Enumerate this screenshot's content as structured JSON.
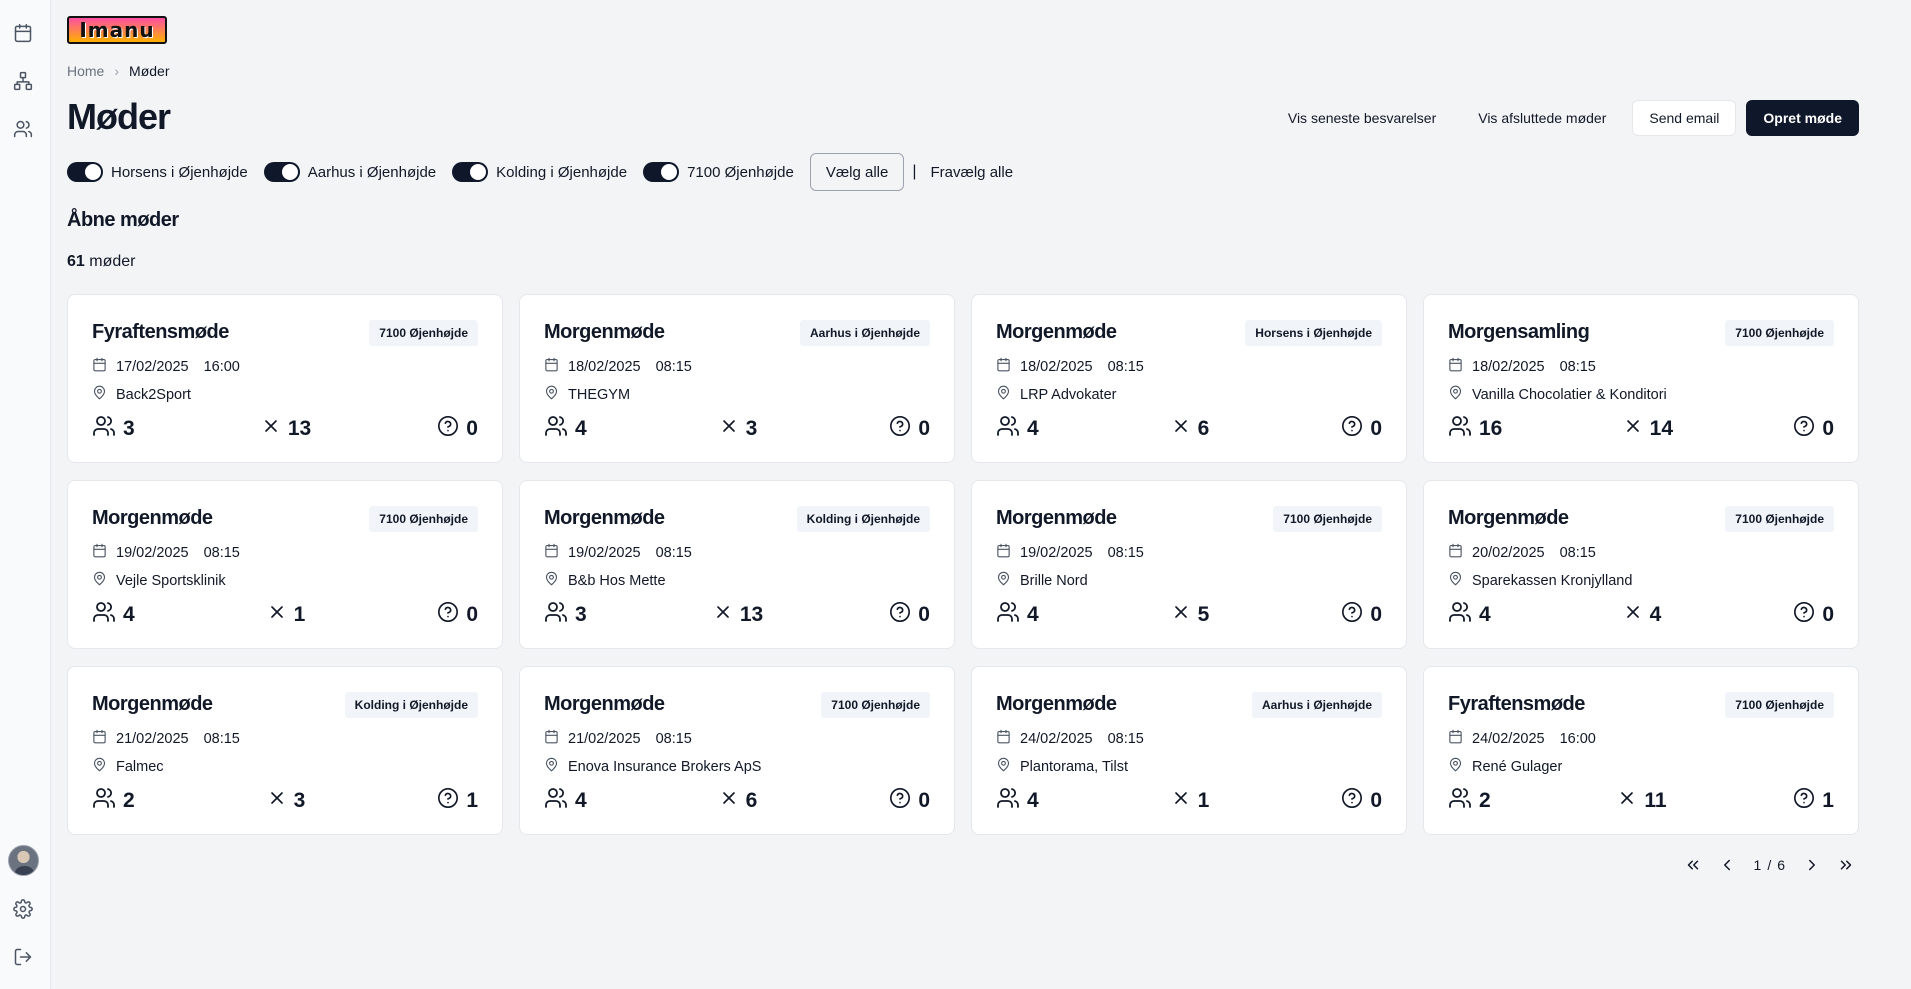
{
  "logo_text": "Imanu",
  "breadcrumb": {
    "home": "Home",
    "current": "Møder"
  },
  "page_title": "Møder",
  "actions": {
    "latest_responses": "Vis seneste besvarelser",
    "closed_meetings": "Vis afsluttede møder",
    "send_email": "Send email",
    "create_meeting": "Opret møde"
  },
  "filters": [
    {
      "label": "Horsens i Øjenhøjde",
      "on": true
    },
    {
      "label": "Aarhus i Øjenhøjde",
      "on": true
    },
    {
      "label": "Kolding i Øjenhøjde",
      "on": true
    },
    {
      "label": "7100 Øjenhøjde",
      "on": true
    }
  ],
  "select_all": "Vælg alle",
  "divider": "|",
  "deselect_all": "Fravælg alle",
  "section_title": "Åbne møder",
  "count": {
    "number": "61",
    "label": "møder"
  },
  "meetings": [
    {
      "title": "Fyraftensmøde",
      "badge": "7100 Øjenhøjde",
      "date": "17/02/2025",
      "time": "16:00",
      "place": "Back2Sport",
      "attending": "3",
      "declined": "13",
      "unknown": "0"
    },
    {
      "title": "Morgenmøde",
      "badge": "Aarhus i Øjenhøjde",
      "date": "18/02/2025",
      "time": "08:15",
      "place": "THEGYM",
      "attending": "4",
      "declined": "3",
      "unknown": "0"
    },
    {
      "title": "Morgenmøde",
      "badge": "Horsens i Øjenhøjde",
      "date": "18/02/2025",
      "time": "08:15",
      "place": "LRP Advokater",
      "attending": "4",
      "declined": "6",
      "unknown": "0"
    },
    {
      "title": "Morgensamling",
      "badge": "7100 Øjenhøjde",
      "date": "18/02/2025",
      "time": "08:15",
      "place": "Vanilla Chocolatier & Konditori",
      "attending": "16",
      "declined": "14",
      "unknown": "0"
    },
    {
      "title": "Morgenmøde",
      "badge": "7100 Øjenhøjde",
      "date": "19/02/2025",
      "time": "08:15",
      "place": "Vejle Sportsklinik",
      "attending": "4",
      "declined": "1",
      "unknown": "0"
    },
    {
      "title": "Morgenmøde",
      "badge": "Kolding i Øjenhøjde",
      "date": "19/02/2025",
      "time": "08:15",
      "place": "B&b Hos Mette",
      "attending": "3",
      "declined": "13",
      "unknown": "0"
    },
    {
      "title": "Morgenmøde",
      "badge": "7100 Øjenhøjde",
      "date": "19/02/2025",
      "time": "08:15",
      "place": "Brille Nord",
      "attending": "4",
      "declined": "5",
      "unknown": "0"
    },
    {
      "title": "Morgenmøde",
      "badge": "7100 Øjenhøjde",
      "date": "20/02/2025",
      "time": "08:15",
      "place": "Sparekassen Kronjylland",
      "attending": "4",
      "declined": "4",
      "unknown": "0"
    },
    {
      "title": "Morgenmøde",
      "badge": "Kolding i Øjenhøjde",
      "date": "21/02/2025",
      "time": "08:15",
      "place": "Falmec",
      "attending": "2",
      "declined": "3",
      "unknown": "1"
    },
    {
      "title": "Morgenmøde",
      "badge": "7100 Øjenhøjde",
      "date": "21/02/2025",
      "time": "08:15",
      "place": "Enova Insurance Brokers ApS",
      "attending": "4",
      "declined": "6",
      "unknown": "0"
    },
    {
      "title": "Morgenmøde",
      "badge": "Aarhus i Øjenhøjde",
      "date": "24/02/2025",
      "time": "08:15",
      "place": "Plantorama, Tilst",
      "attending": "4",
      "declined": "1",
      "unknown": "0"
    },
    {
      "title": "Fyraftensmøde",
      "badge": "7100 Øjenhøjde",
      "date": "24/02/2025",
      "time": "16:00",
      "place": "René Gulager",
      "attending": "2",
      "declined": "11",
      "unknown": "1"
    }
  ],
  "pagination": {
    "current": "1",
    "separator": "/",
    "total": "6"
  },
  "icons": {
    "sidebar": [
      "calendar-icon",
      "org-chart-icon",
      "users-icon",
      "settings-icon",
      "logout-icon"
    ],
    "card": [
      "calendar-icon",
      "map-pin-icon",
      "users-icon",
      "x-icon",
      "help-circle-icon"
    ],
    "pagination": [
      "chevrons-left-icon",
      "chevron-left-icon",
      "chevron-right-icon",
      "chevrons-right-icon"
    ]
  },
  "colors": {
    "primary": "#0f172a",
    "background": "#f3f4f6",
    "card": "#ffffff",
    "badge_bg": "#f1f5f9",
    "muted_text": "#6b7280"
  }
}
